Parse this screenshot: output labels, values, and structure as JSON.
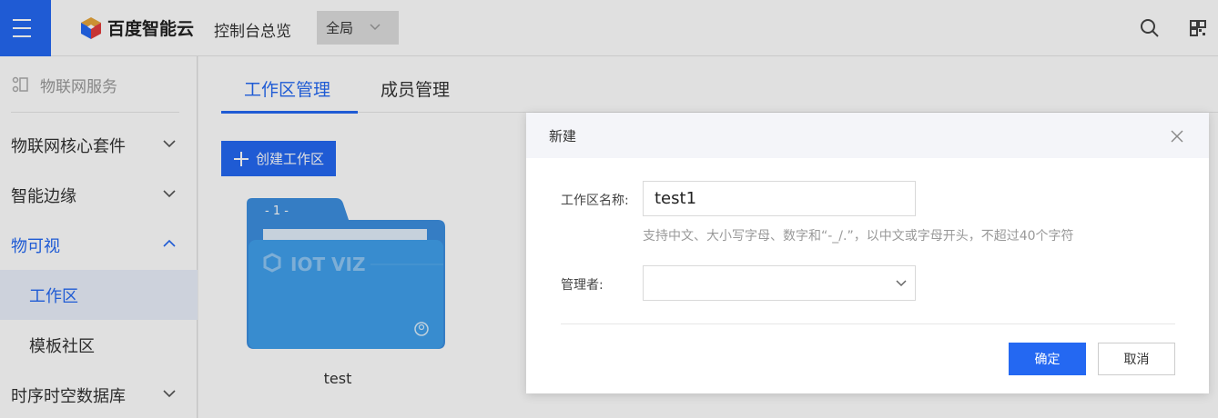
{
  "header": {
    "brand": "百度智能云",
    "console_link": "控制台总览",
    "region": "全局"
  },
  "sidebar": {
    "title": "物联网服务",
    "items": [
      {
        "label": "物联网核心套件"
      },
      {
        "label": "智能边缘"
      },
      {
        "label": "物可视"
      },
      {
        "label": "工作区"
      },
      {
        "label": "模板社区"
      },
      {
        "label": "时序时空数据库"
      }
    ]
  },
  "main": {
    "tabs": [
      {
        "label": "工作区管理"
      },
      {
        "label": "成员管理"
      }
    ],
    "create_button": "创建工作区",
    "card": {
      "badge": "- 1 -",
      "watermark": "IOT VIZ",
      "caption": "test"
    }
  },
  "modal": {
    "title": "新建",
    "name_label": "工作区名称:",
    "name_value": "test1",
    "hint": "支持中文、大小写字母、数字和“-_/.”，以中文或字母开头，不超过40个字符",
    "manager_label": "管理者:",
    "manager_value": "",
    "ok_label": "确定",
    "cancel_label": "取消"
  },
  "colors": {
    "accent": "#2468f2",
    "folder": "#3d9ae6"
  }
}
